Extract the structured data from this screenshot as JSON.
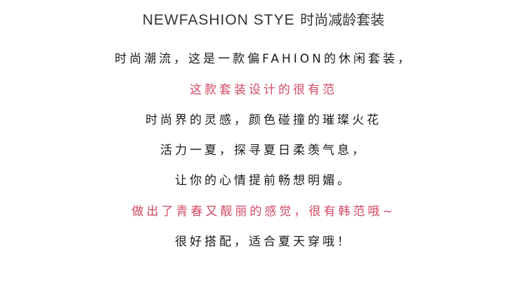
{
  "header": {
    "title_en": "NEWFASHION STYE",
    "title_cn": "时尚减龄套装"
  },
  "description": {
    "lines": [
      {
        "text": "时尚潮流，这是一款偏FAHION的休闲套装，",
        "color": "#1a1a1a"
      },
      {
        "text": "这款套装设计的很有范",
        "color": "#d24a64"
      },
      {
        "text": "时尚界的灵感，颜色碰撞的璀璨火花",
        "color": "#1a1a1a"
      },
      {
        "text": "活力一夏，探寻夏日柔羡气息，",
        "color": "#1a1a1a"
      },
      {
        "text": "让你的心情提前畅想明媚。",
        "color": "#1a1a1a"
      },
      {
        "text": "做出了青春又靓丽的感觉，很有韩范哦~",
        "color": "#d24a64"
      },
      {
        "text": "很好搭配，适合夏天穿哦！",
        "color": "#1a1a1a"
      }
    ]
  }
}
